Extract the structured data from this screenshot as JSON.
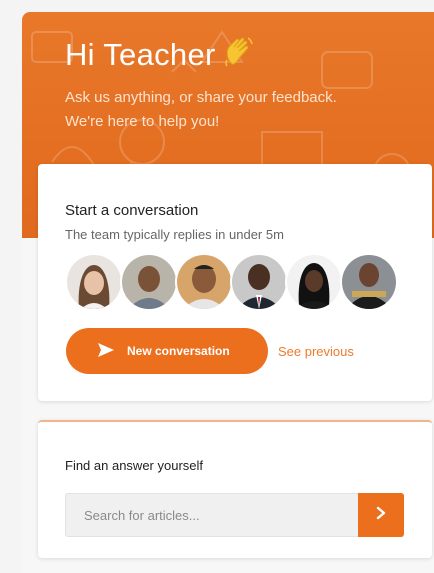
{
  "header": {
    "greeting": "Hi Teacher",
    "wave_icon": "waving-hand-icon",
    "subtitle_line1": "Ask us anything, or share your feedback.",
    "subtitle_line2": "We're here to help you!"
  },
  "conversation": {
    "title": "Start a conversation",
    "reply_time": "The team typically replies in under 5m",
    "team_avatars": [
      "avatar-1",
      "avatar-2",
      "avatar-3",
      "avatar-4",
      "avatar-5",
      "avatar-6"
    ],
    "new_button_label": "New conversation",
    "new_button_icon": "send-icon",
    "see_previous_label": "See previous"
  },
  "help": {
    "title": "Find an answer yourself",
    "search_placeholder": "Search for articles...",
    "search_button_icon": "chevron-right-icon"
  },
  "colors": {
    "brand_orange": "#ec6f1e",
    "header_orange": "#e46f22",
    "link_orange": "#ee7a2d"
  }
}
